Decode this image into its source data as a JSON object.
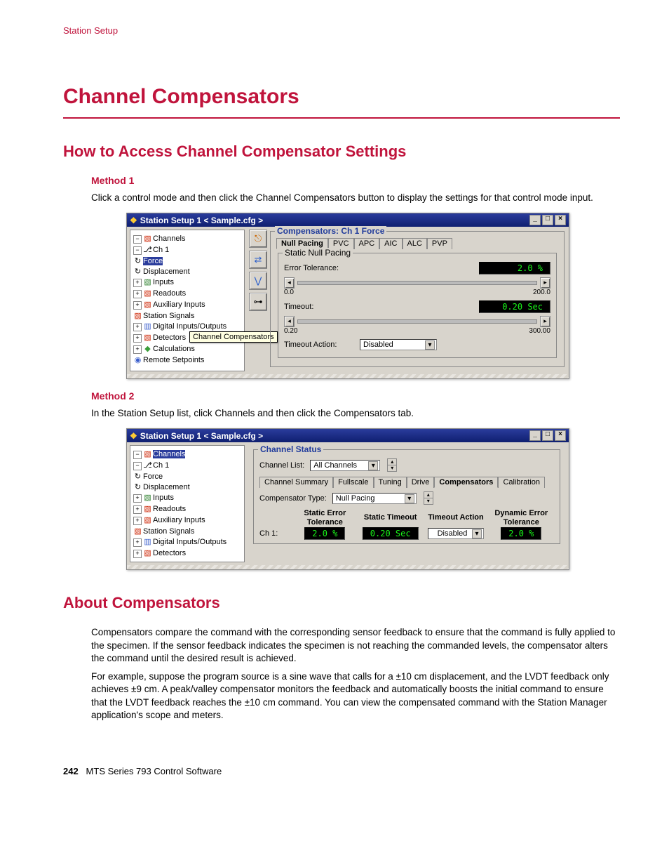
{
  "running_head": "Station Setup",
  "chapter_title": "Channel Compensators",
  "section_access": "How to Access Channel Compensator Settings",
  "method1": {
    "title": "Method 1",
    "body": "Click a control mode and then click the Channel Compensators button to display the settings for that control mode input."
  },
  "method2": {
    "title": "Method 2",
    "body": "In the Station Setup list, click Channels and then click the Compensators tab."
  },
  "about": {
    "title": "About Compensators",
    "p1": "Compensators compare the command with the corresponding sensor feedback to ensure that the command is fully applied to the specimen. If the sensor feedback indicates the specimen is not reaching the commanded levels, the compensator alters the command until the desired result is achieved.",
    "p2": "For example, suppose the program source is a sine wave that calls for a ±10 cm displacement, and the LVDT feedback only achieves ±9 cm. A peak/valley compensator monitors the feedback and automatically boosts the initial command to ensure that the LVDT feedback reaches the ±10 cm command. You can view the compensated command with the Station Manager application's scope and meters."
  },
  "footer": {
    "page": "242",
    "doc": "MTS Series 793 Control Software"
  },
  "win1": {
    "title": "Station Setup 1 < Sample.cfg >",
    "tree": {
      "channels": "Channels",
      "ch1": "Ch 1",
      "force": "Force",
      "displacement": "Displacement",
      "inputs": "Inputs",
      "readouts": "Readouts",
      "aux_inputs": "Auxiliary Inputs",
      "station_signals": "Station Signals",
      "digital_io": "Digital Inputs/Outputs",
      "detectors": "Detectors",
      "calculations": "Calculations",
      "remote_setpoints": "Remote Setpoints"
    },
    "tooltip": "Channel Compensators",
    "group_title": "Compensators:  Ch 1 Force",
    "tabs": [
      "Null Pacing",
      "PVC",
      "APC",
      "AIC",
      "ALC",
      "PVP"
    ],
    "static_null": {
      "group": "Static Null Pacing",
      "err_label": "Error Tolerance:",
      "err_val": "2.0  %",
      "err_min": "0.0",
      "err_max": "200.0",
      "to_label": "Timeout:",
      "to_val": "0.20  Sec",
      "to_min": "0.20",
      "to_max": "300.00",
      "action_label": "Timeout Action:",
      "action_val": "Disabled"
    }
  },
  "win2": {
    "title": "Station Setup 1 < Sample.cfg >",
    "group_title": "Channel Status",
    "list_label": "Channel List:",
    "list_val": "All Channels",
    "tabs": [
      "Channel Summary",
      "Fullscale",
      "Tuning",
      "Drive",
      "Compensators",
      "Calibration"
    ],
    "type_label": "Compensator Type:",
    "type_val": "Null Pacing",
    "headers": {
      "c1": "Static Error Tolerance",
      "c2": "Static Timeout",
      "c3": "Timeout Action",
      "c4": "Dynamic Error Tolerance"
    },
    "row": {
      "ch": "Ch 1:",
      "c1": "2.0  %",
      "c2": "0.20  Sec",
      "c3": "Disabled",
      "c4": "2.0  %"
    }
  }
}
